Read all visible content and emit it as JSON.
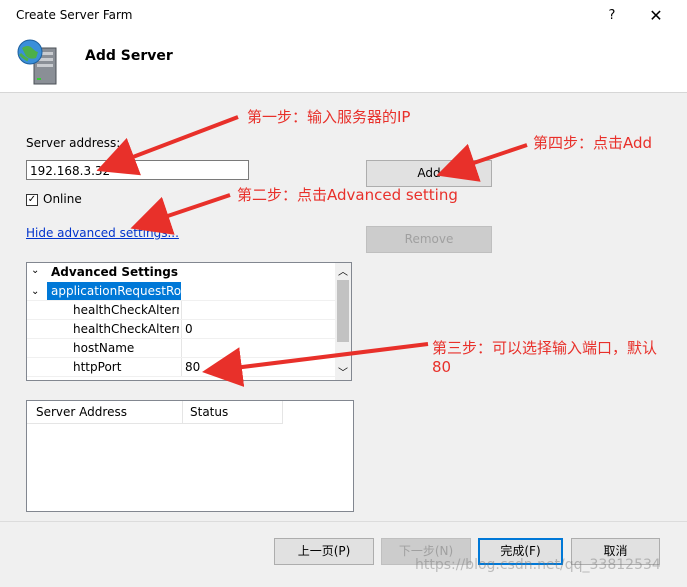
{
  "window": {
    "title": "Create Server Farm",
    "help": "?",
    "close": "✕"
  },
  "header": {
    "title": "Add Server",
    "icon": "server-globe-icon"
  },
  "form": {
    "server_address_label": "Server address:",
    "server_address_value": "192.168.3.32",
    "online_label": "Online",
    "online_checked": "✓",
    "advanced_link": "Hide advanced settings...",
    "add_button": "Add",
    "remove_button": "Remove"
  },
  "properties": {
    "header": "Advanced Settings",
    "group": "applicationRequestRo",
    "rows": [
      {
        "name": "healthCheckAlterna",
        "value": ""
      },
      {
        "name": "healthCheckAlterna",
        "value": "0"
      },
      {
        "name": "hostName",
        "value": ""
      },
      {
        "name": "httpPort",
        "value": "80"
      }
    ]
  },
  "server_list": {
    "columns": [
      "Server Address",
      "Status"
    ]
  },
  "footer": {
    "prev": "上一页(P)",
    "next": "下一步(N)",
    "finish": "完成(F)",
    "cancel": "取消"
  },
  "annotations": {
    "step1": "第一步：输入服务器的IP",
    "step2": "第二步：点击Advanced setting",
    "step3_line1": "第三步：可以选择输入端口，默认",
    "step3_line2": "80",
    "step4": "第四步：点击Add"
  },
  "watermark": "https://blog.csdn.net/qq_33812534",
  "colors": {
    "annotation": "#e8302a",
    "link": "#0033cc",
    "selection": "#0078d7"
  }
}
